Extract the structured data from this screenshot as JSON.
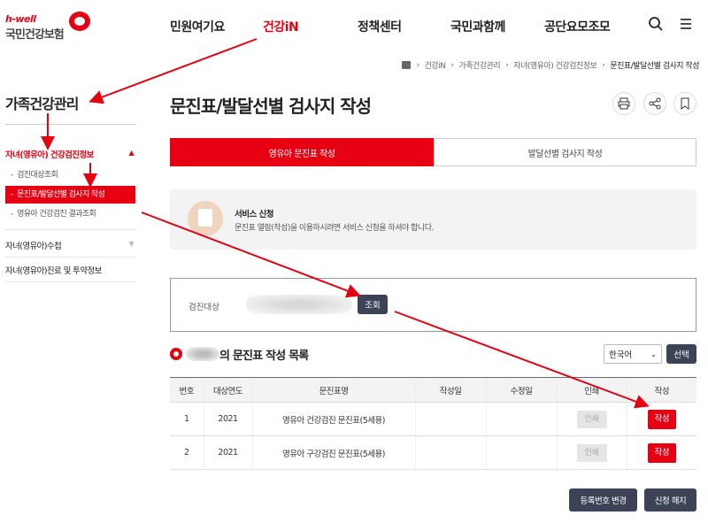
{
  "logo": {
    "top": "h-well",
    "main": "국민건강보험"
  },
  "gnb": [
    "민원여기요",
    "건강iN",
    "정책센터",
    "국민과함께",
    "공단요모조모"
  ],
  "breadcrumb": [
    "건강iN",
    "가족건강관리",
    "자녀(영유아) 건강검진정보",
    "문진표/발달선별 검사지 작성"
  ],
  "lnb": {
    "title": "가족건강관리",
    "group1": "자녀(영유아) 건강검진정보",
    "sub": [
      "검진대상조회",
      "문진표/발달선별 검사지 작성",
      "영유아 건강검진 결과조회"
    ],
    "group2": "자녀(영유아)수첩",
    "group3": "자녀(영유아)진료 및 투약정보"
  },
  "page": {
    "title": "문진표/발달선별 검사지 작성"
  },
  "tabs": [
    "영유아 문진표 작성",
    "발달선별 검사지 작성"
  ],
  "service": {
    "title": "서비스 신청",
    "desc": "문진표 열람(작성)을 이용하시려면 서비스 신청을 하셔야 합니다."
  },
  "search": {
    "label": "검진대상",
    "button": "조회"
  },
  "list": {
    "title": "의 문진표 작성 목록",
    "lang": "한국어",
    "select": "선택"
  },
  "table": {
    "headers": [
      "번호",
      "대상연도",
      "문진표명",
      "작성일",
      "수정일",
      "인쇄",
      "작성"
    ],
    "rows": [
      {
        "no": "1",
        "year": "2021",
        "name": "영유아 건강검진 문진표(5세용)",
        "written": "",
        "modified": "",
        "print": "인쇄",
        "write": "작성"
      },
      {
        "no": "2",
        "year": "2021",
        "name": "영유아 구강검진 문진표(5세용)",
        "written": "",
        "modified": "",
        "print": "인쇄",
        "write": "작성"
      }
    ]
  },
  "buttons": {
    "change": "등록번호 변경",
    "cancel": "신청 해지"
  },
  "colors": {
    "brand": "#e60012",
    "dark_button": "#3c4356"
  },
  "icons": [
    "search-icon",
    "menu-icon",
    "home-icon",
    "print-icon",
    "share-icon",
    "bookmark-icon"
  ]
}
